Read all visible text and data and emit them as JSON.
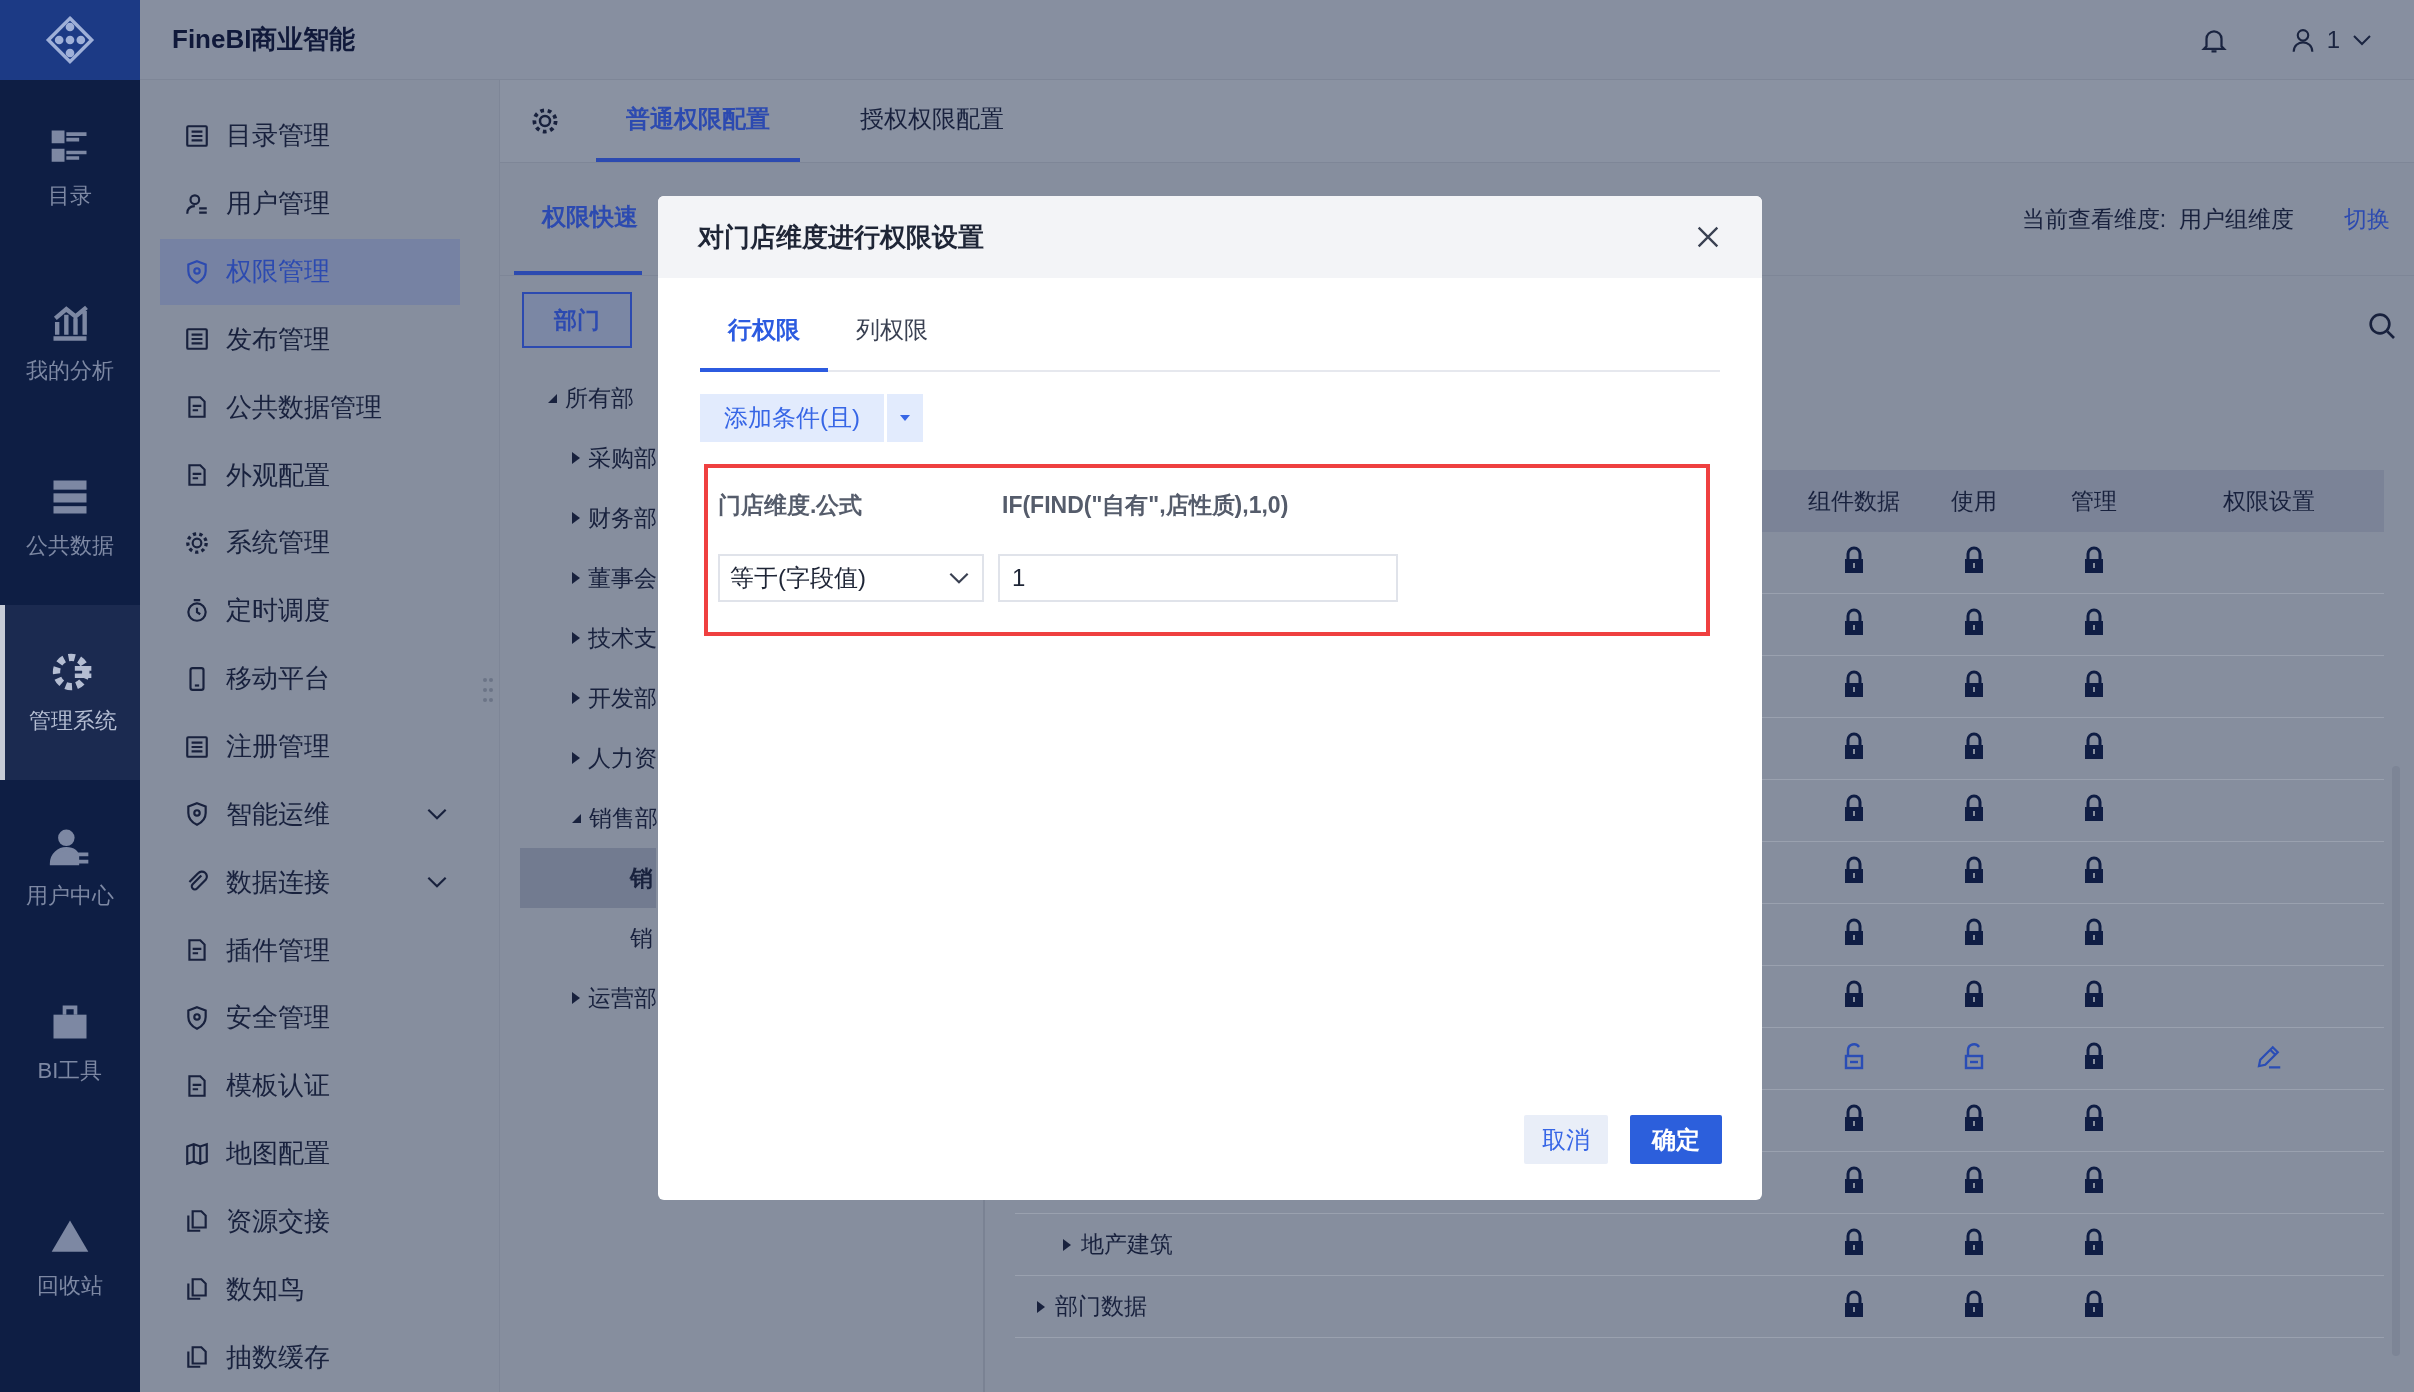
{
  "rail": {
    "items": [
      {
        "label": "目录",
        "selected": false
      },
      {
        "label": "我的分析",
        "selected": false
      },
      {
        "label": "公共数据",
        "selected": false
      },
      {
        "label": "管理系统",
        "selected": true
      },
      {
        "label": "用户中心",
        "selected": false
      },
      {
        "label": "BI工具",
        "selected": false
      },
      {
        "label": "回收站",
        "selected": false
      }
    ]
  },
  "topbar": {
    "title": "FineBI商业智能",
    "user": "1"
  },
  "menu": {
    "items": [
      {
        "label": "目录管理",
        "selected": false,
        "has_submenu": false
      },
      {
        "label": "用户管理",
        "selected": false,
        "has_submenu": false
      },
      {
        "label": "权限管理",
        "selected": true,
        "has_submenu": false
      },
      {
        "label": "发布管理",
        "selected": false,
        "has_submenu": false
      },
      {
        "label": "公共数据管理",
        "selected": false,
        "has_submenu": false
      },
      {
        "label": "外观配置",
        "selected": false,
        "has_submenu": false
      },
      {
        "label": "系统管理",
        "selected": false,
        "has_submenu": false
      },
      {
        "label": "定时调度",
        "selected": false,
        "has_submenu": false
      },
      {
        "label": "移动平台",
        "selected": false,
        "has_submenu": false
      },
      {
        "label": "注册管理",
        "selected": false,
        "has_submenu": false
      },
      {
        "label": "智能运维",
        "selected": false,
        "has_submenu": true
      },
      {
        "label": "数据连接",
        "selected": false,
        "has_submenu": true
      },
      {
        "label": "插件管理",
        "selected": false,
        "has_submenu": false
      },
      {
        "label": "安全管理",
        "selected": false,
        "has_submenu": false
      },
      {
        "label": "模板认证",
        "selected": false,
        "has_submenu": false
      },
      {
        "label": "地图配置",
        "selected": false,
        "has_submenu": false
      },
      {
        "label": "资源交接",
        "selected": false,
        "has_submenu": false
      },
      {
        "label": "数知鸟",
        "selected": false,
        "has_submenu": false
      },
      {
        "label": "抽数缓存",
        "selected": false,
        "has_submenu": false
      }
    ]
  },
  "main": {
    "tabs": [
      {
        "label": "普通权限配置",
        "selected": true
      },
      {
        "label": "授权权限配置",
        "selected": false
      }
    ],
    "subtabs": [
      {
        "label": "权限快速",
        "selected": true
      }
    ],
    "dimension": {
      "label": "当前查看维度:  用户组维度",
      "switch": "切换"
    },
    "dept_button": "部门",
    "tree": [
      {
        "label": "所有部",
        "expanded": true,
        "selected": false,
        "children": [
          {
            "label": "采购部",
            "expanded": false,
            "selected": false
          },
          {
            "label": "财务部",
            "expanded": false,
            "selected": false
          },
          {
            "label": "董事会",
            "expanded": false,
            "selected": false
          },
          {
            "label": "技术支",
            "expanded": false,
            "selected": false
          },
          {
            "label": "开发部",
            "expanded": false,
            "selected": false
          },
          {
            "label": "人力资",
            "expanded": false,
            "selected": false
          },
          {
            "label": "销售部",
            "expanded": true,
            "selected": false,
            "children": [
              {
                "label": "销",
                "selected": true
              },
              {
                "label": "销",
                "selected": false
              }
            ]
          },
          {
            "label": "运营部",
            "expanded": false,
            "selected": false
          }
        ]
      }
    ],
    "table": {
      "columns": [
        "组件数据",
        "使用",
        "管理",
        "权限设置"
      ],
      "rows": [
        {
          "locks": [
            true,
            true,
            true
          ],
          "editable": false
        },
        {
          "locks": [
            true,
            true,
            true
          ],
          "editable": false
        },
        {
          "locks": [
            true,
            true,
            true
          ],
          "editable": false
        },
        {
          "locks": [
            true,
            true,
            true
          ],
          "editable": false
        },
        {
          "locks": [
            true,
            true,
            true
          ],
          "editable": false
        },
        {
          "locks": [
            true,
            true,
            true
          ],
          "editable": false
        },
        {
          "locks": [
            true,
            true,
            true
          ],
          "editable": false
        },
        {
          "locks": [
            true,
            true,
            true
          ],
          "editable": false
        },
        {
          "locks": [
            false,
            false,
            true
          ],
          "editable": true
        },
        {
          "locks": [
            true,
            true,
            true
          ],
          "editable": false
        },
        {
          "locks": [
            true,
            true,
            true
          ],
          "editable": false,
          "children": [
            {
              "name": "地产建筑",
              "expanded": false,
              "locks": [
                true,
                true,
                true
              ],
              "editable": false
            }
          ]
        },
        {
          "name": "部门数据",
          "expanded": false,
          "locks": [
            true,
            true,
            true
          ],
          "editable": false
        }
      ]
    }
  },
  "dialog": {
    "title": "对门店维度进行权限设置",
    "tabs": [
      {
        "label": "行权限",
        "selected": true
      },
      {
        "label": "列权限",
        "selected": false
      }
    ],
    "add_button": "添加条件(且)",
    "condition": {
      "field": "门店维度.公式",
      "formula": "IF(FIND(\"自有\",店性质),1,0)",
      "operator": "等于(字段值)",
      "value": "1",
      "highlighted": true
    },
    "buttons": [
      {
        "label": "取消",
        "kind": "secondary"
      },
      {
        "label": "确定",
        "kind": "primary"
      }
    ]
  }
}
